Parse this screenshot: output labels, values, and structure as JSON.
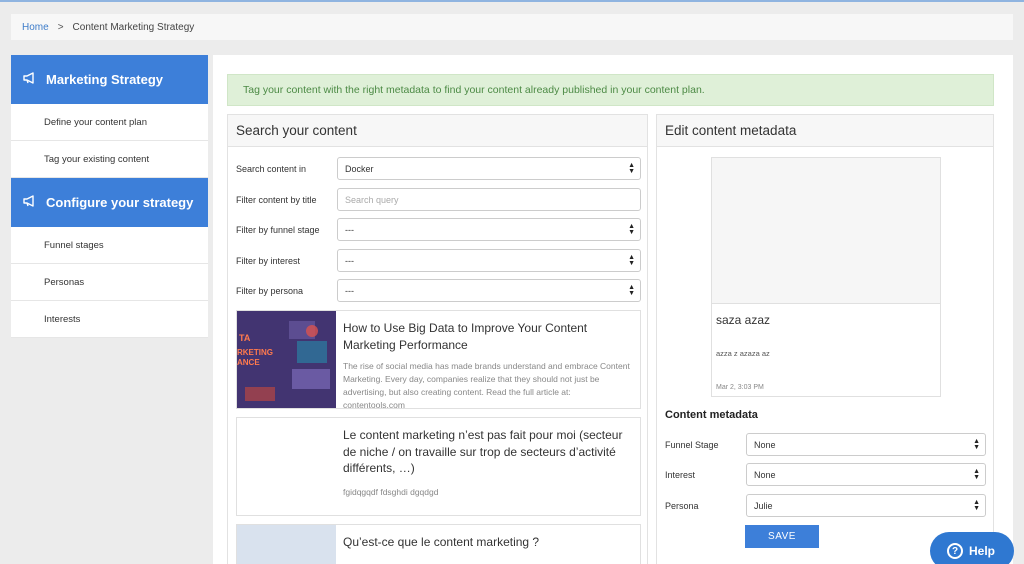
{
  "breadcrumb": {
    "home": "Home",
    "separator": ">",
    "current": "Content Marketing Strategy"
  },
  "sidebar": {
    "sections": [
      {
        "title": "Marketing Strategy",
        "icon": "megaphone-icon",
        "items": [
          "Define your content plan",
          "Tag your existing content"
        ]
      },
      {
        "title": "Configure your strategy",
        "icon": "megaphone-icon",
        "items": [
          "Funnel stages",
          "Personas",
          "Interests"
        ]
      }
    ]
  },
  "alert": {
    "text": "Tag your content with the right metadata to find your content already published in your content plan."
  },
  "search": {
    "title": "Search your content",
    "filters": {
      "source": {
        "label": "Search content in",
        "value": "Docker"
      },
      "title": {
        "label": "Filter content by title",
        "placeholder": "Search query"
      },
      "funnel": {
        "label": "Filter by funnel stage",
        "value": "---"
      },
      "interest": {
        "label": "Filter by interest",
        "value": "---"
      },
      "persona": {
        "label": "Filter by persona",
        "value": "---"
      }
    },
    "results": [
      {
        "title": "How to Use Big Data to Improve Your Content Marketing Performance",
        "description": "The rise of social media has made brands understand and embrace Content Marketing. Every day, companies realize that they should not just be advertising, but also creating content. Read the full article at: contentools.com",
        "thumb_text": [
          "TA",
          "RKETING",
          "ANCE"
        ]
      },
      {
        "title": "Le content marketing n’est pas fait pour moi (secteur de niche / on travaille sur trop de secteurs d’activité différents, …)",
        "description": "fgidqgqdf fdsghdi dgqdgd"
      },
      {
        "title": "Qu’est-ce que le content marketing ?"
      }
    ]
  },
  "edit": {
    "title": "Edit content metadata",
    "preview": {
      "title": "saza azaz",
      "description": "azza z azaza az",
      "date": "Mar 2, 3:03 PM"
    },
    "metadata_heading": "Content metadata",
    "fields": {
      "funnel": {
        "label": "Funnel Stage",
        "value": "None"
      },
      "interest": {
        "label": "Interest",
        "value": "None"
      },
      "persona": {
        "label": "Persona",
        "value": "Julie"
      }
    },
    "save_label": "SAVE"
  },
  "help": {
    "label": "Help"
  }
}
